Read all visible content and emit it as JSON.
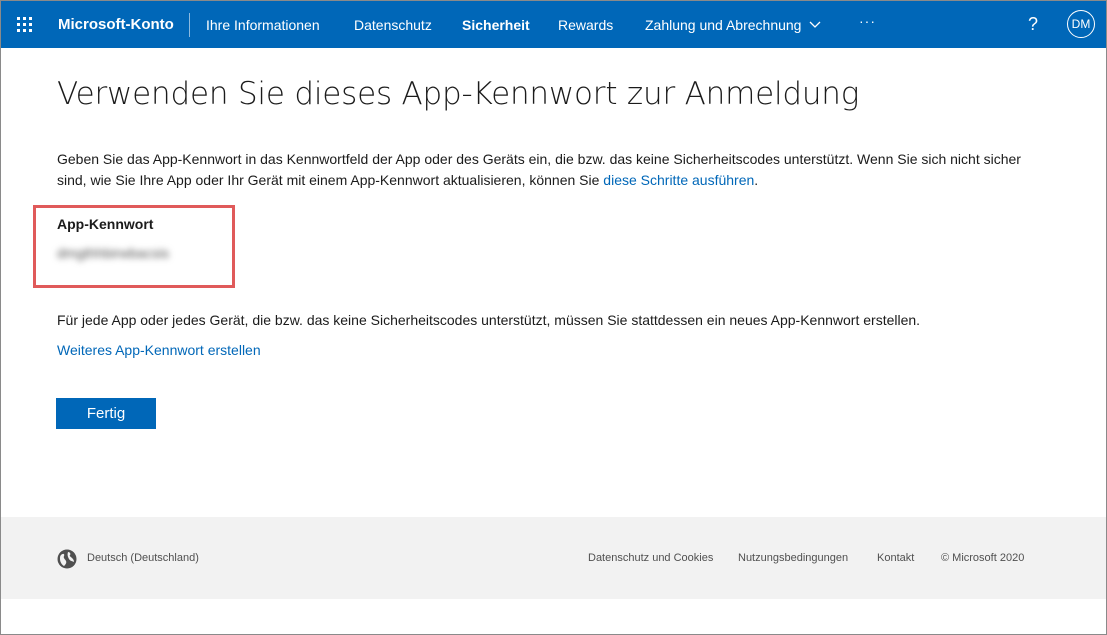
{
  "header": {
    "brand": "Microsoft-Konto",
    "nav": {
      "info": "Ihre Informationen",
      "privacy": "Datenschutz",
      "security": "Sicherheit",
      "rewards": "Rewards",
      "billing": "Zahlung und Abrechnung"
    },
    "more": "···",
    "help": "?",
    "avatar_initials": "DM"
  },
  "main": {
    "title": "Verwenden Sie dieses App-Kennwort zur Anmeldung",
    "intro_text": "Geben Sie das App-Kennwort in das Kennwortfeld der App oder des Geräts ein, die bzw. das keine Sicherheitscodes unterstützt. Wenn Sie sich nicht sicher sind, wie Sie Ihre App oder Ihr Gerät mit einem App-Kennwort aktualisieren, können Sie ",
    "intro_link": "diese Schritte ausführen",
    "intro_end": ".",
    "password_label": "App-Kennwort",
    "password_value": "dmgthhbirwbacsis",
    "note": "Für jede App oder jedes Gerät, die bzw. das keine Sicherheitscodes unterstützt, müssen Sie stattdessen ein neues App-Kennwort erstellen.",
    "create_link": "Weiteres App-Kennwort erstellen",
    "done_button": "Fertig"
  },
  "footer": {
    "language": "Deutsch (Deutschland)",
    "privacy_cookies": "Datenschutz und Cookies",
    "terms": "Nutzungsbedingungen",
    "contact": "Kontakt",
    "copyright": "© Microsoft 2020"
  },
  "colors": {
    "brand_blue": "#0067b8",
    "highlight_red": "#e05a5a",
    "footer_bg": "#f2f2f2"
  }
}
